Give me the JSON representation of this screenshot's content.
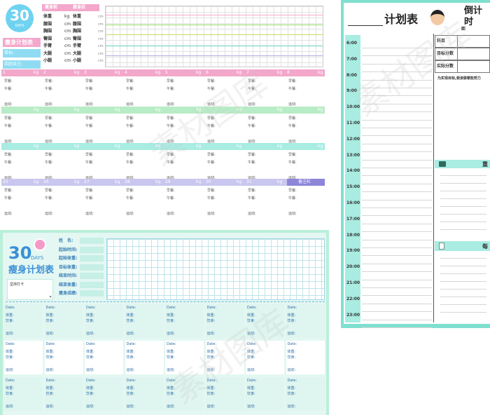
{
  "panel_a": {
    "badge_number": "30",
    "badge_word": "DAYS",
    "tabs": [
      "瘦身前",
      "瘦身后"
    ],
    "subtitle": "瘦身计划表",
    "fields_left": [
      "目标:",
      "奖励自己:"
    ],
    "measure_rows": [
      {
        "a": "体重",
        "u1": "kg",
        "b": "体重"
      },
      {
        "a": "腰围",
        "u1": "cm",
        "b": "腰围"
      },
      {
        "a": "胸围",
        "u1": "cm",
        "b": "胸围"
      },
      {
        "a": "臀围",
        "u1": "cm",
        "b": "臀围"
      },
      {
        "a": "手臂",
        "u1": "cm",
        "b": "手臂"
      },
      {
        "a": "大腿",
        "u1": "cm",
        "b": "大腿"
      },
      {
        "a": "小腿",
        "u1": "cm",
        "b": "小腿"
      }
    ],
    "chart_y_unit": "cm",
    "day_unit": "kg",
    "row1_days": [
      "1",
      "2",
      "3",
      "4",
      "5",
      "6",
      "7",
      "8"
    ],
    "row4_days": [
      "25",
      "26",
      "27",
      "28",
      "29",
      "30",
      "31"
    ],
    "note_label": "备注栏",
    "cell_labels": [
      "早餐:",
      "午餐:",
      "晚餐:",
      "运动:"
    ]
  },
  "panel_b": {
    "title_num": "30",
    "title_word": "DAYS",
    "title": "瘦身计划表",
    "tagline": "坚持打卡",
    "tag_mark": "✕",
    "info": [
      "姓　名:",
      "起始时间:",
      "起始体重:",
      "目标体重:",
      "结束时间:",
      "结束体重:",
      "瘦身成绩:"
    ],
    "cell_labels": [
      "Date:",
      "体重:",
      "饮食:",
      "运动:"
    ]
  },
  "panel_c": {
    "title": "计划表",
    "header_right": "倒计时",
    "sub_right": "距",
    "times": [
      "6:00",
      "7:00",
      "8:00",
      "9:00",
      "10:00",
      "11:00",
      "12:00",
      "13:00",
      "14:00",
      "15:00",
      "16:00",
      "17:00",
      "18:00",
      "19:00",
      "20:00",
      "21:00",
      "22:00",
      "23:00"
    ],
    "table_rows": [
      "科目",
      "目标分数",
      "实际分数"
    ],
    "note": "为实现目标,我该做哪些努力",
    "sec_a": "重",
    "sec_b": "每"
  },
  "watermark": "素材图库",
  "colors": {
    "pink": "#f0a6c9",
    "green": "#b8ecc6",
    "cyan": "#a8ece2",
    "lavender": "#c9c6ef",
    "teal": "#7fe0cf",
    "blue": "#5aa0d8"
  }
}
